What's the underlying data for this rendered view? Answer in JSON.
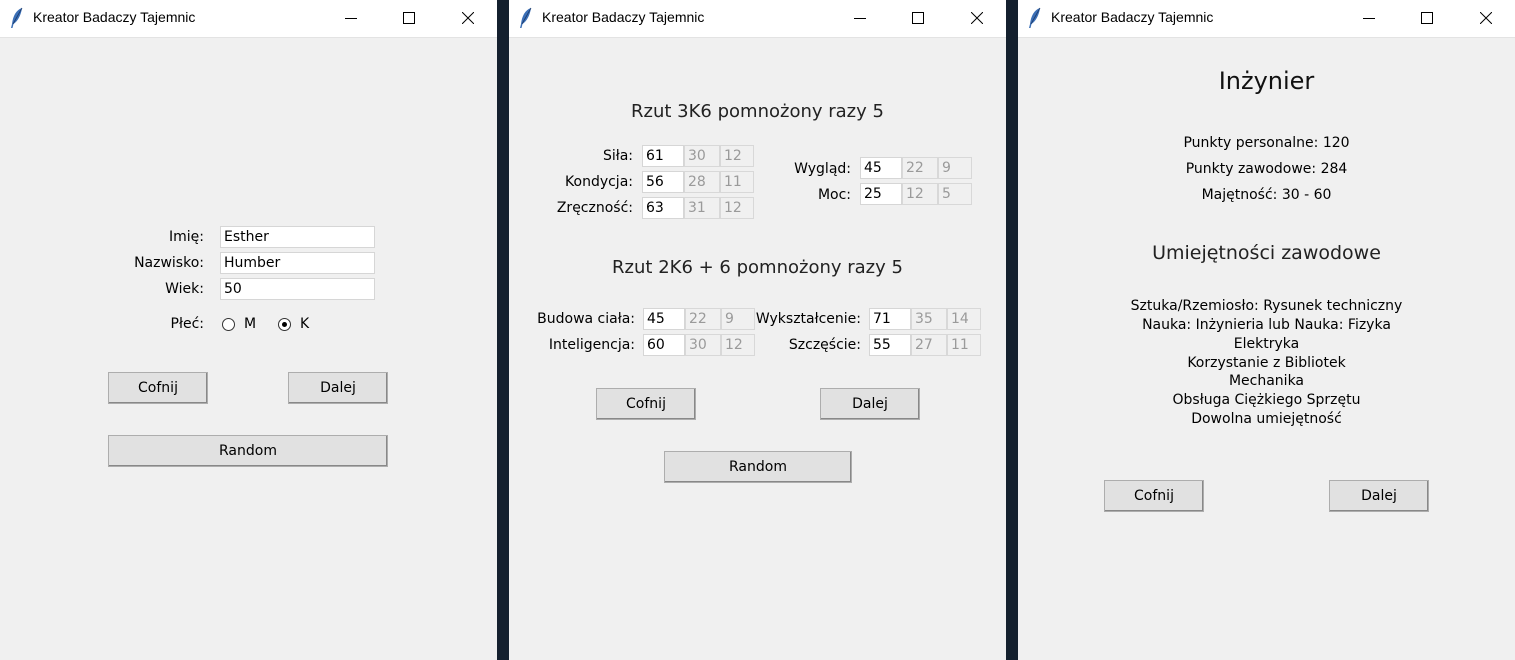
{
  "windows": [
    {
      "title": "Kreator Badaczy Tajemnic",
      "form": {
        "name_label": "Imię:",
        "name_value": "Esther",
        "surname_label": "Nazwisko:",
        "surname_value": "Humber",
        "age_label": "Wiek:",
        "age_value": "50",
        "sex_label": "Płeć:",
        "sex_options": [
          "M",
          "K"
        ],
        "sex_selected": "K"
      },
      "buttons": {
        "back": "Cofnij",
        "next": "Dalej",
        "random": "Random"
      }
    },
    {
      "title": "Kreator Badaczy Tajemnic",
      "heading_3k6": "Rzut 3K6 pomnożony razy 5",
      "stats_3k6_left": [
        {
          "label": "Siła:",
          "value": "61",
          "half": "30",
          "fifth": "12"
        },
        {
          "label": "Kondycja:",
          "value": "56",
          "half": "28",
          "fifth": "11"
        },
        {
          "label": "Zręczność:",
          "value": "63",
          "half": "31",
          "fifth": "12"
        }
      ],
      "stats_3k6_right": [
        {
          "label": "Wygląd:",
          "value": "45",
          "half": "22",
          "fifth": "9"
        },
        {
          "label": "Moc:",
          "value": "25",
          "half": "12",
          "fifth": "5"
        }
      ],
      "heading_2k6": "Rzut 2K6 + 6 pomnożony razy 5",
      "stats_2k6_left": [
        {
          "label": "Budowa ciała:",
          "value": "45",
          "half": "22",
          "fifth": "9"
        },
        {
          "label": "Inteligencja:",
          "value": "60",
          "half": "30",
          "fifth": "12"
        }
      ],
      "stats_2k6_right": [
        {
          "label": "Wykształcenie:",
          "value": "71",
          "half": "35",
          "fifth": "14"
        },
        {
          "label": "Szczęście:",
          "value": "55",
          "half": "27",
          "fifth": "11"
        }
      ],
      "buttons": {
        "back": "Cofnij",
        "next": "Dalej",
        "random": "Random"
      }
    },
    {
      "title": "Kreator Badaczy Tajemnic",
      "profession": "Inżynier",
      "points_personal": "Punkty personalne: 120",
      "points_occupation": "Punkty zawodowe: 284",
      "wealth": "Majętność: 30 - 60",
      "skills_heading": "Umiejętności zawodowe",
      "skills": [
        "Sztuka/Rzemiosło: Rysunek techniczny",
        "Nauka: Inżynieria lub Nauka: Fizyka",
        "Elektryka",
        "Korzystanie z Bibliotek",
        "Mechanika",
        "Obsługa Ciężkiego Sprzętu",
        "Dowolna umiejętność"
      ],
      "buttons": {
        "back": "Cofnij",
        "next": "Dalej"
      }
    }
  ]
}
